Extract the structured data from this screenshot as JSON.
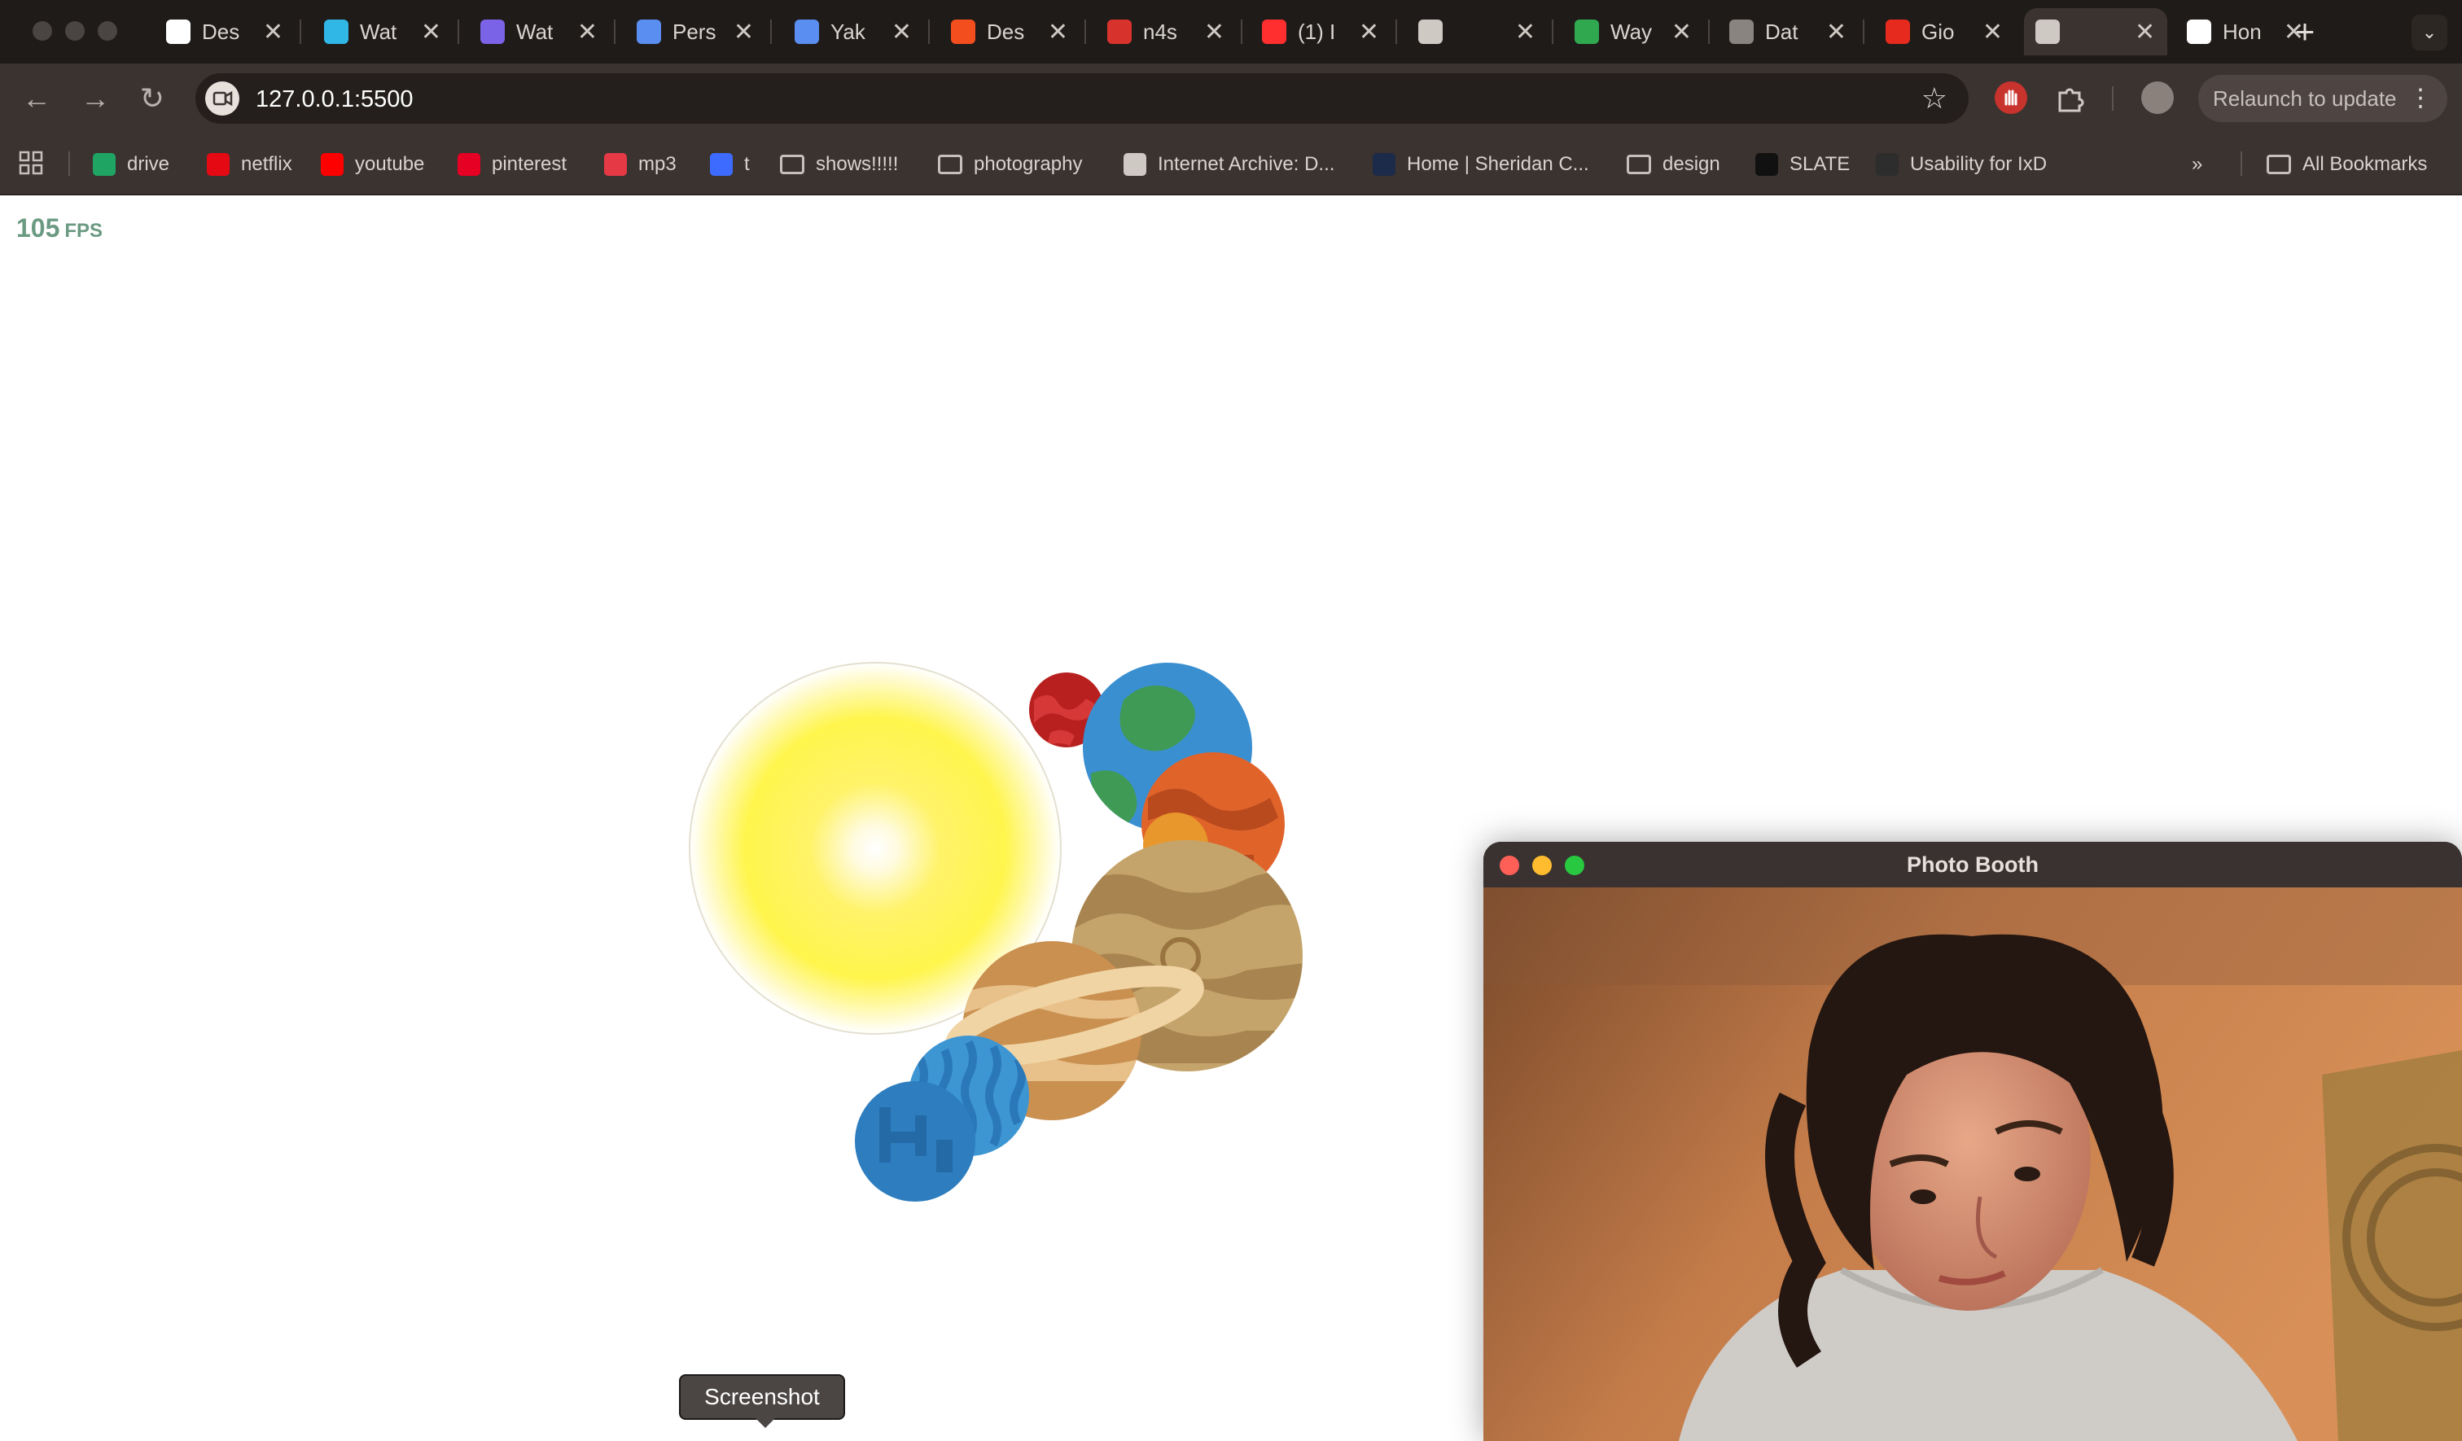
{
  "browser": {
    "tabs": [
      {
        "title": "Des",
        "favicon": "notion-icon",
        "color": "#ffffff"
      },
      {
        "title": "Wat",
        "favicon": "s-logo-icon",
        "color": "#30b7e6"
      },
      {
        "title": "Wat",
        "favicon": "video-icon",
        "color": "#7a63e6"
      },
      {
        "title": "Pers",
        "favicon": "link-icon",
        "color": "#5a8ef0"
      },
      {
        "title": "Yak",
        "favicon": "link-icon",
        "color": "#5a8ef0"
      },
      {
        "title": "Des",
        "favicon": "figma-icon",
        "color": "#f24e1e"
      },
      {
        "title": "n4s",
        "favicon": "os-icon",
        "color": "#d8322d"
      },
      {
        "title": "(1) I",
        "favicon": "youtube-icon",
        "color": "#ff2f2f"
      },
      {
        "title": "",
        "favicon": "globe-icon",
        "color": "#cfc9c4"
      },
      {
        "title": "Way",
        "favicon": "td-icon",
        "color": "#2fa84f"
      },
      {
        "title": "Dat",
        "favicon": "generic-icon",
        "color": "#8a8480"
      },
      {
        "title": "Gio",
        "favicon": "ted-icon",
        "color": "#e62b1e"
      },
      {
        "title": "",
        "favicon": "globe-icon",
        "color": "#cfc9c4"
      },
      {
        "title": "Hon",
        "favicon": "d2l-icon",
        "color": "#ffffff"
      }
    ],
    "tab_close_glyph": "✕",
    "new_tab_glyph": "+",
    "tab_menu_glyph": "⌄",
    "url": "127.0.0.1:5500",
    "relaunch_label": "Relaunch to update",
    "relaunch_menu_glyph": "⋮",
    "bookmarks": [
      {
        "label": "drive",
        "kind": "icon",
        "color": "#1fa463"
      },
      {
        "label": "netflix",
        "kind": "icon",
        "color": "#e50914"
      },
      {
        "label": "youtube",
        "kind": "icon",
        "color": "#ff0000"
      },
      {
        "label": "pinterest",
        "kind": "icon",
        "color": "#e60023"
      },
      {
        "label": "mp3",
        "kind": "icon",
        "color": "#e63946"
      },
      {
        "label": "t",
        "kind": "icon",
        "color": "#3d6bff"
      },
      {
        "label": "shows!!!!!",
        "kind": "folder"
      },
      {
        "label": "photography",
        "kind": "folder"
      },
      {
        "label": "Internet Archive: D...",
        "kind": "icon",
        "color": "#cfc9c4"
      },
      {
        "label": "Home | Sheridan C...",
        "kind": "icon",
        "color": "#1c2b4a"
      },
      {
        "label": "design",
        "kind": "folder"
      },
      {
        "label": "SLATE",
        "kind": "icon",
        "color": "#111111"
      },
      {
        "label": "Usability for IxD",
        "kind": "icon",
        "color": "#2d2d2d"
      }
    ],
    "bookmarks_overflow": "»",
    "all_bookmarks_label": "All Bookmarks"
  },
  "page": {
    "fps_value": "105",
    "fps_unit": "FPS",
    "tooltip": "Screenshot"
  },
  "photobooth": {
    "title": "Photo Booth"
  }
}
